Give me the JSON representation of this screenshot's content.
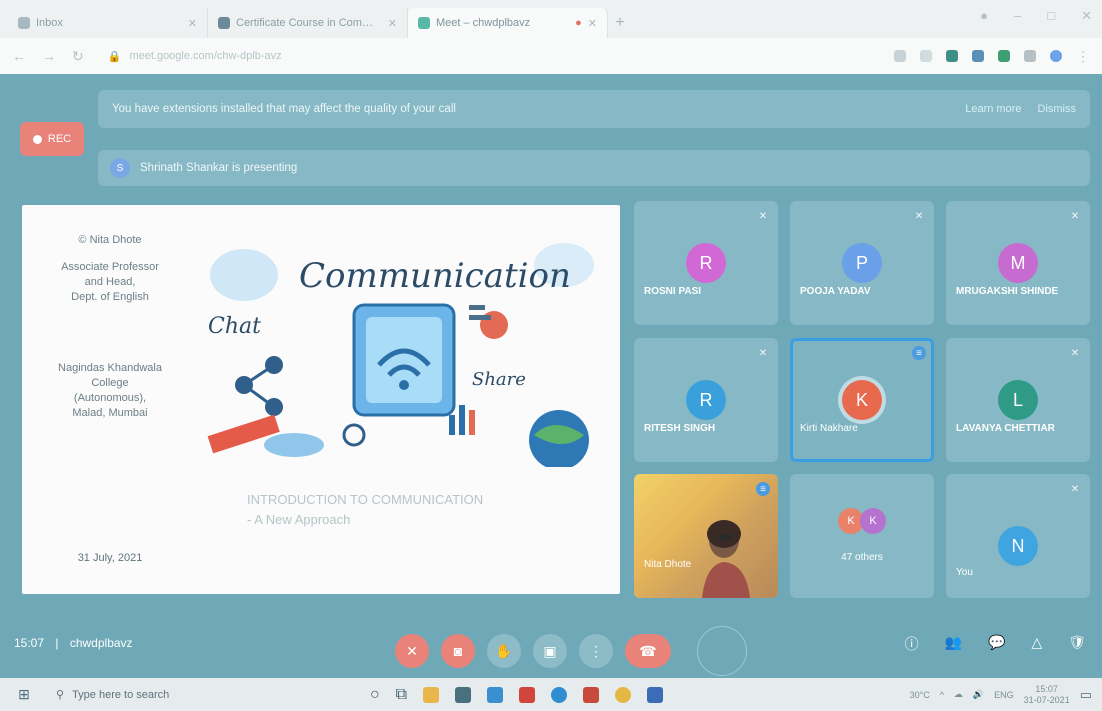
{
  "browser": {
    "tabs": [
      {
        "title": "Inbox",
        "favicon_color": "#a7b9c0",
        "active": false
      },
      {
        "title": "Certificate Course in Communication",
        "favicon_color": "#6a8a9a",
        "active": false
      },
      {
        "title": "Meet – chwdplbavz",
        "favicon_color": "#5ab8a6",
        "active": true
      }
    ],
    "address": "meet.google.com/chw-dplb-avz",
    "window_controls": [
      "–",
      "□",
      "✕"
    ]
  },
  "meet": {
    "rec_label": "REC",
    "banner": {
      "message": "You have extensions installed that may affect the quality of your call",
      "link1": "Learn more",
      "link2": "Dismiss"
    },
    "presenting": {
      "initial": "S",
      "text": "Shrinath Shankar is presenting"
    },
    "slide": {
      "author_lines": [
        "© Nita Dhote"
      ],
      "role_lines": [
        "Associate Professor",
        "and Head,",
        "Dept. of English"
      ],
      "college_lines": [
        "Nagindas Khandwala",
        "College",
        "(Autonomous),",
        "Malad, Mumbai"
      ],
      "date": "31 July, 2021",
      "art_words": {
        "main": "Communication",
        "left": "Chat",
        "right": "Share"
      },
      "credit": "",
      "title_line1": "INTRODUCTION TO COMMUNICATION",
      "title_line2": "- A New Approach"
    },
    "participants": [
      {
        "initial": "R",
        "name": "ROSNI PASI",
        "color": "#d168d6",
        "mic": "muted"
      },
      {
        "initial": "P",
        "name": "POOJA YADAV",
        "color": "#6aa0e8",
        "mic": "muted"
      },
      {
        "initial": "M",
        "name": "MRUGAKSHI SHINDE",
        "color": "#c66bd0",
        "mic": "muted"
      },
      {
        "initial": "R",
        "name": "RITESH SINGH",
        "color": "#3aa0dc",
        "mic": "muted"
      },
      {
        "initial": "K",
        "name": "Kirti Nakhare",
        "color": "#e86a4e",
        "mic": "speaking"
      },
      {
        "initial": "L",
        "name": "LAVANYA CHETTIAR",
        "color": "#2f9b86",
        "mic": "muted"
      }
    ],
    "video_tile": {
      "name": "Nita Dhote",
      "mic": "speaking"
    },
    "others_tile": {
      "initials": [
        "K",
        "K"
      ],
      "colors": [
        "#e8826a",
        "#b572cf"
      ],
      "label": "47 others"
    },
    "you_tile": {
      "initial": "N",
      "name": "You",
      "color": "#3fa5e0",
      "mic": "muted"
    },
    "controls": {
      "time": "15:07",
      "separator": "|",
      "meeting_code": "chwdplbavz"
    }
  },
  "taskbar": {
    "search_placeholder": "Type here to search",
    "weather": "30°C",
    "lang": "ENG",
    "time": "15:07",
    "date": "31-07-2021"
  }
}
